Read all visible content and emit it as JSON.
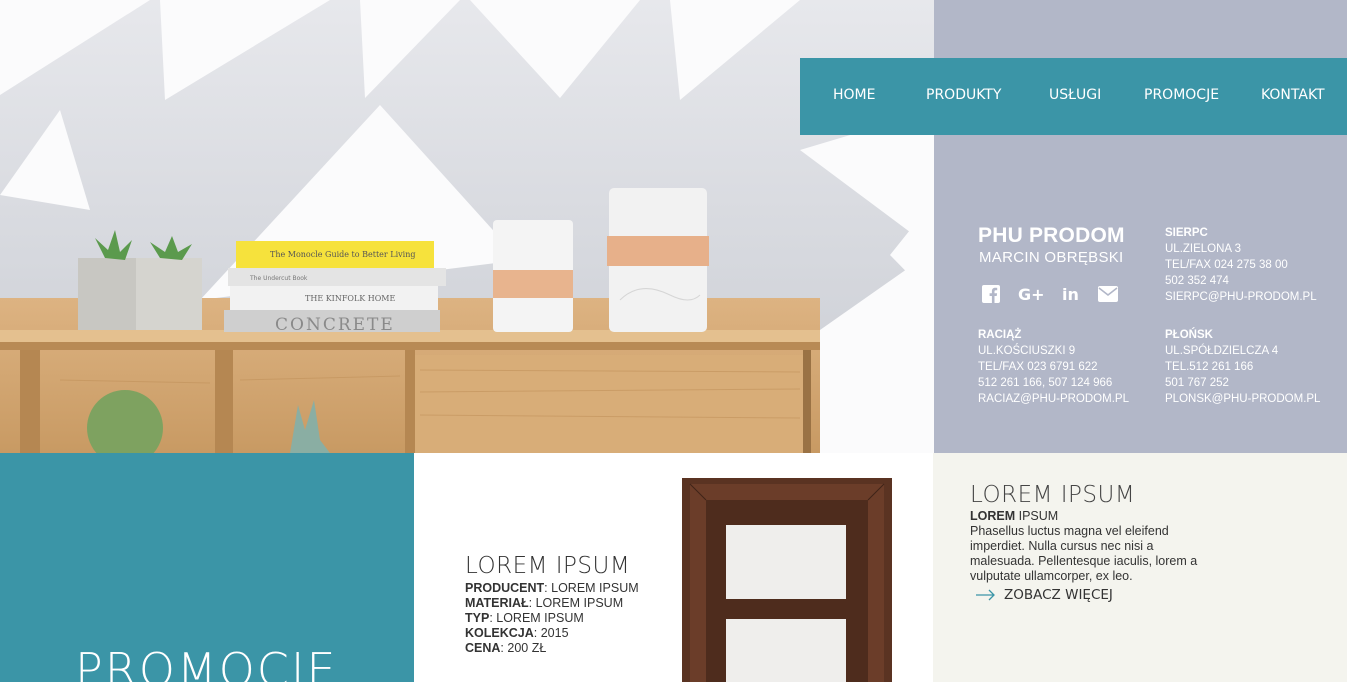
{
  "nav": {
    "items": [
      {
        "label": "HOME"
      },
      {
        "label": "PRODUKTY"
      },
      {
        "label": "USŁUGI"
      },
      {
        "label": "PROMOCJE"
      },
      {
        "label": "KONTAKT"
      }
    ]
  },
  "company": {
    "name": "PHU PRODOM",
    "owner": "MARCIN OBRĘBSKI",
    "social_icons": [
      "facebook-icon",
      "google-plus-icon",
      "linkedin-icon",
      "email-icon"
    ]
  },
  "offices": [
    {
      "city": "SIERPC",
      "lines": [
        "UL.ZIELONA 3",
        "TEL/FAX 024 275 38 00",
        "502 352 474",
        "SIERPC@PHU-PRODOM.PL"
      ]
    },
    {
      "city": "RACIĄŻ",
      "lines": [
        "UL.KOŚCIUSZKI 9",
        "TEL/FAX 023 6791 622",
        "512 261 166, 507 124 966",
        "RACIAZ@PHU-PRODOM.PL"
      ]
    },
    {
      "city": "PŁOŃSK",
      "lines": [
        "UL.SPÓŁDZIELCZA 4",
        "TEL.512 261 166",
        "501 767 252",
        "PLONSK@PHU-PRODOM.PL"
      ]
    }
  ],
  "promo": {
    "title": "PROMOCJE"
  },
  "product": {
    "title": "LOREM IPSUM",
    "specs": [
      {
        "key": "PRODUCENT",
        "value": ": LOREM IPSUM"
      },
      {
        "key": "MATERIAŁ",
        "value": ": LOREM IPSUM"
      },
      {
        "key": "TYP",
        "value": ": LOREM IPSUM"
      },
      {
        "key": "KOLEKCJA",
        "value": ": 2015"
      },
      {
        "key": "CENA",
        "value": ": 200 ZŁ"
      }
    ]
  },
  "side": {
    "title": "LOREM IPSUM",
    "sub_bold": "LOREM",
    "sub_rest": " IPSUM",
    "text": "Phasellus luctus magna vel eleifend imperdiet. Nulla cursus nec nisi a malesuada. Pellentesque iaculis, lorem a vulputate ullamcorper, ex leo.",
    "more": "ZOBACZ WIĘCEJ"
  },
  "hero": {
    "book_labels": [
      "The Monocle Guide to Better Living",
      "The Undercut Book",
      "THE KINFOLK HOME",
      "CONCRETE"
    ]
  },
  "colors": {
    "teal": "#3b95a7",
    "panel": "#b2b7c8",
    "cream": "#f4f4ee",
    "wood": "#d2a874"
  }
}
